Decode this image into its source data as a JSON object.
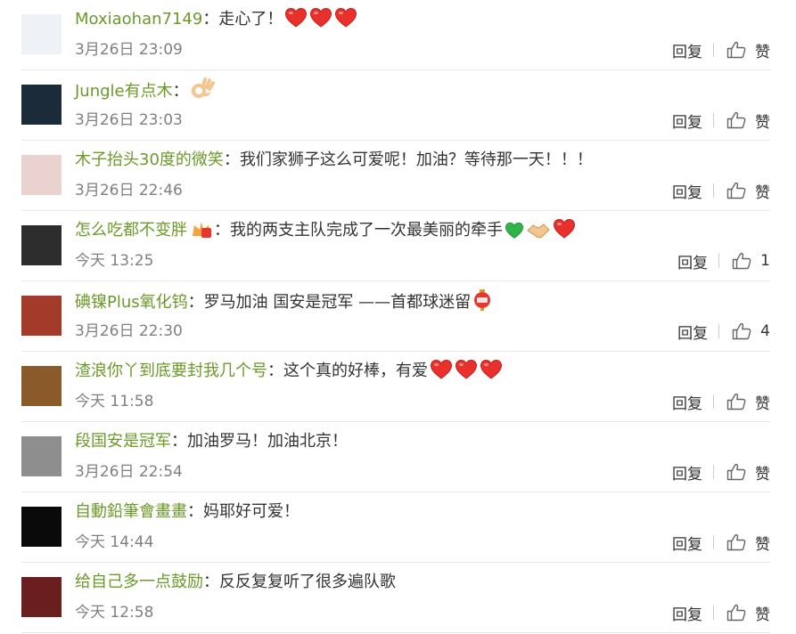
{
  "comments": [
    {
      "user": "Moxiaohan7149",
      "text": "走心了！",
      "emojis": [
        "heart",
        "heart",
        "heart"
      ],
      "time": "3月26日 23:09",
      "reply": "回复",
      "like": "赞",
      "avatar_color": "#eef2f6"
    },
    {
      "user": "Jungle有点木",
      "text": "",
      "emojis": [
        "ok-hand"
      ],
      "time": "3月26日 23:03",
      "reply": "回复",
      "like": "赞",
      "avatar_color": "#1c2b3a"
    },
    {
      "user": "木子抬头30度的微笑",
      "text": "我们家狮子这么可爱呢！加油？等待那一天！！！",
      "emojis": [],
      "time": "3月26日 22:46",
      "reply": "回复",
      "like": "赞",
      "avatar_color": "#e9d2d0"
    },
    {
      "user": "怎么吃都不变胖",
      "text": "我的两支主队完成了一次最美丽的牵手",
      "emojis": [
        "green-heart",
        "handshake",
        "heart"
      ],
      "badge": "badge",
      "time": "今天 13:25",
      "reply": "回复",
      "like": "1",
      "avatar_color": "#2d2d2d"
    },
    {
      "user": "碘镍Plus氧化钨",
      "text": "罗马加油 国安是冠军 ——首都球迷留",
      "emojis": [
        "lantern"
      ],
      "time": "3月26日 22:30",
      "reply": "回复",
      "like": "4",
      "avatar_color": "#a43a2a"
    },
    {
      "user": "渣浪你丫到底要封我几个号",
      "text": "这个真的好棒，有爱",
      "emojis": [
        "heart",
        "heart",
        "heart"
      ],
      "time": "今天 11:58",
      "reply": "回复",
      "like": "赞",
      "avatar_color": "#8a5a2b"
    },
    {
      "user": "段国安是冠军",
      "text": "加油罗马！加油北京！",
      "emojis": [],
      "time": "3月26日 22:54",
      "reply": "回复",
      "like": "赞",
      "avatar_color": "#8e8e8e"
    },
    {
      "user": "自動鉛筆會畫畫",
      "text": "妈耶好可爱！",
      "emojis": [],
      "time": "今天 14:44",
      "reply": "回复",
      "like": "赞",
      "avatar_color": "#0a0a0a"
    },
    {
      "user": "给自己多一点鼓励",
      "text": "反反复复听了很多遍队歌",
      "emojis": [],
      "time": "今天 12:58",
      "reply": "回复",
      "like": "赞",
      "avatar_color": "#6a1e1e"
    }
  ],
  "colors": {
    "username": "#6b9a2a",
    "time": "#808080",
    "divider": "#e8e8e8",
    "heart": "#e8302c"
  }
}
